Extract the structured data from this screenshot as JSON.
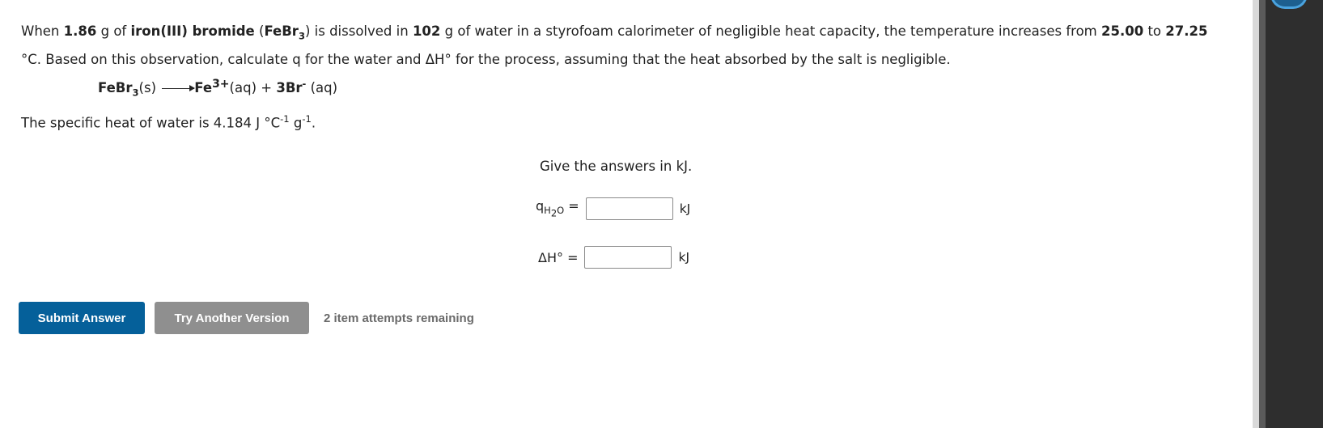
{
  "question": {
    "p1": "When ",
    "mass_salt": "1.86",
    "p2": " g of ",
    "compound_name": "iron(III) bromide",
    "p3": " (",
    "formula_base": "FeBr",
    "formula_sub": "3",
    "p4": ") is dissolved in ",
    "mass_water": "102",
    "p5": " g of water in a styrofoam calorimeter of negligible heat capacity, the temperature increases from ",
    "t_initial": "25.00",
    "p6": " to ",
    "t_final": "27.25",
    "p7": " °C. Based on this observation, calculate q for the water and ΔH° for the process, assuming that the heat absorbed by the salt is negligible."
  },
  "equation": {
    "reactant_base": "FeBr",
    "reactant_sub": "3",
    "reactant_state": "(s)",
    "product1_base": "Fe",
    "product1_charge": "3+",
    "product1_state": "(aq)",
    "plus": " + ",
    "product2_base": "3Br",
    "product2_charge": "-",
    "product2_state": " (aq)"
  },
  "specific_heat": {
    "text": "The specific heat of water is 4.184 J °C",
    "exp1": "-1",
    "mid": " g",
    "exp2": "-1",
    "end": "."
  },
  "answers": {
    "title": "Give the answers in kJ.",
    "q_label_base": "q",
    "q_label_sub1": "H",
    "q_label_sub2": "2",
    "q_label_sub3": "O",
    "q_equals": " =",
    "q_unit": "kJ",
    "dh_label": "ΔH° =",
    "dh_unit": "kJ"
  },
  "buttons": {
    "submit": "Submit Answer",
    "try_another": "Try Another Version"
  },
  "attempts": "2 item attempts remaining"
}
